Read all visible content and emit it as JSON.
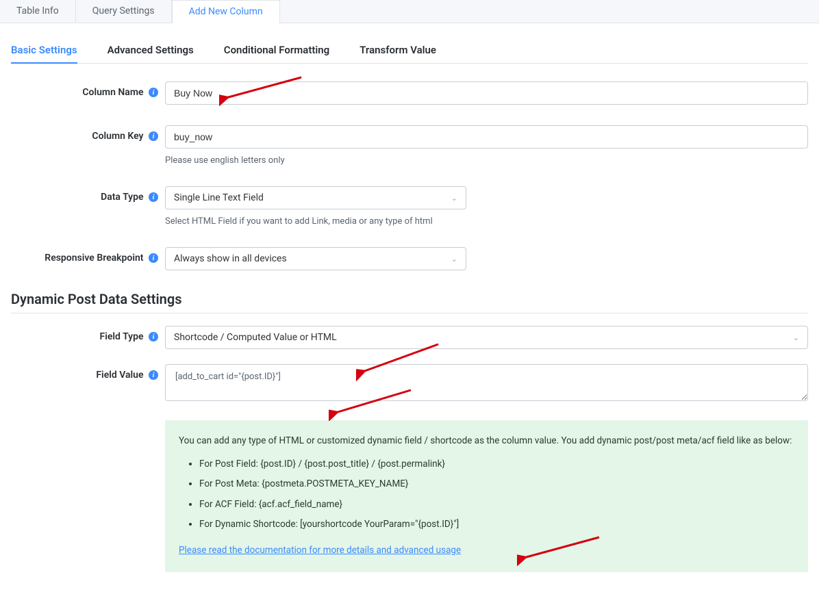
{
  "topTabs": {
    "tableInfo": "Table Info",
    "querySettings": "Query Settings",
    "addNewColumn": "Add New Column"
  },
  "subTabs": {
    "basicSettings": "Basic Settings",
    "advancedSettings": "Advanced Settings",
    "conditionalFormatting": "Conditional Formatting",
    "transformValue": "Transform Value"
  },
  "labels": {
    "columnName": "Column Name",
    "columnKey": "Column Key",
    "dataType": "Data Type",
    "responsiveBreakpoint": "Responsive Breakpoint",
    "fieldType": "Field Type",
    "fieldValue": "Field Value"
  },
  "fields": {
    "columnName": "Buy Now",
    "columnKey": "buy_now",
    "dataType": "Single Line Text Field",
    "responsiveBreakpoint": "Always show in all devices",
    "fieldType": "Shortcode / Computed Value or HTML",
    "fieldValue": "[add_to_cart id=\"{post.ID}\"]"
  },
  "helperText": {
    "columnKey": "Please use english letters only",
    "dataType": "Select HTML Field if you want to add Link, media or any type of html"
  },
  "sectionHeading": "Dynamic Post Data Settings",
  "infoBox": {
    "intro": "You can add any type of HTML or customized dynamic field / shortcode as the column value. You add dynamic post/post meta/acf field like as below:",
    "items": [
      "For Post Field: {post.ID} / {post.post_title} / {post.permalink}",
      "For Post Meta: {postmeta.POSTMETA_KEY_NAME}",
      "For ACF Field: {acf.acf_field_name}",
      "For Dynamic Shortcode: [yourshortcode YourParam=\"{post.ID}\"]"
    ],
    "linkText": "Please read the documentation for more details and advanced usage"
  },
  "infoIconGlyph": "i"
}
